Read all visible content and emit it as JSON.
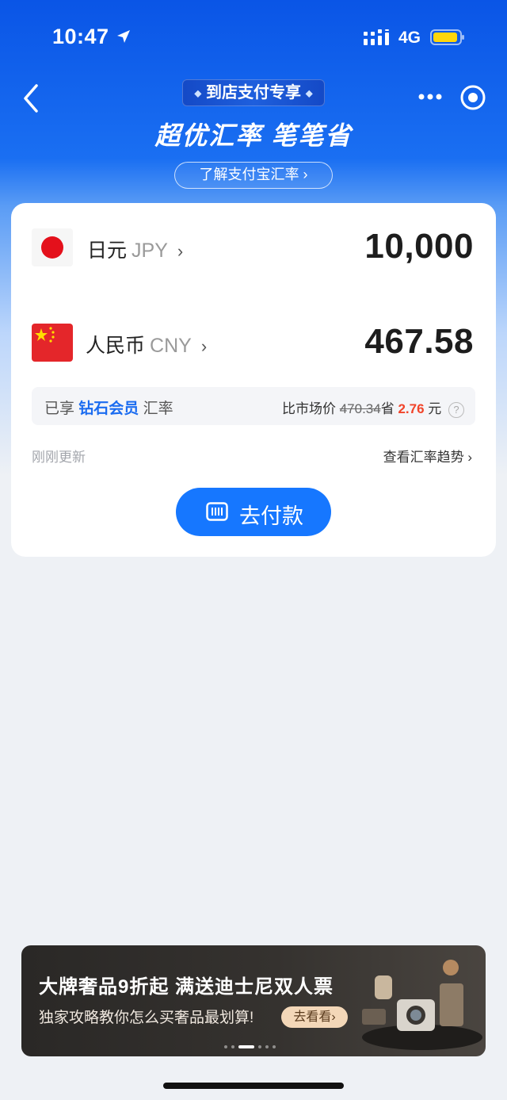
{
  "status_bar": {
    "time": "10:47",
    "network": "4G"
  },
  "header": {
    "tag": "到店支付专享",
    "headline": "超优汇率 笔笔省",
    "learn_link": "了解支付宝汇率 ›"
  },
  "converter": {
    "from": {
      "name": "日元",
      "code": "JPY",
      "amount": "10,000"
    },
    "to": {
      "name": "人民币",
      "code": "CNY",
      "amount": "467.58"
    },
    "rate_info": {
      "prefix": "已享",
      "member": "钻石会员",
      "suffix": "汇率",
      "compare_label": "比市场价",
      "market_price": "470.34",
      "save_label": "省",
      "save_amount": "2.76",
      "unit": "元"
    },
    "updated": "刚刚更新",
    "trend_link": "查看汇率趋势 ›",
    "pay_button": "去付款"
  },
  "banner": {
    "title": "大牌奢品9折起 满送迪士尼双人票",
    "subtitle": "独家攻略教你怎么买奢品最划算!",
    "cta": "去看看›",
    "active_page": 3,
    "total_pages": 6
  },
  "colors": {
    "primary": "#1677ff",
    "save": "#f1442a",
    "vip": "#1b6cf0"
  },
  "icons": [
    "location-arrow-icon",
    "signal-icon",
    "battery-icon",
    "back-icon",
    "more-icon",
    "record-icon",
    "chevron-right-icon",
    "question-icon",
    "payment-code-icon"
  ]
}
